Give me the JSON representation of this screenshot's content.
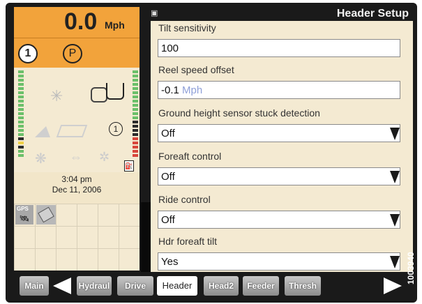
{
  "status": {
    "speed_value": "0.0",
    "speed_unit": "Mph",
    "gear": "1",
    "park": "P",
    "control_badge": "1",
    "fuel": "⛽",
    "time": "3:04 pm",
    "date": "Dec 11, 2006",
    "gps_label": "GPS"
  },
  "header": {
    "title": "Header Setup"
  },
  "settings": [
    {
      "label": "Tilt sensitivity",
      "value": "100",
      "unit": "",
      "dropdown": false
    },
    {
      "label": "Reel speed offset",
      "value": "-0.1",
      "unit": "Mph",
      "dropdown": false
    },
    {
      "label": "Ground height sensor stuck detection",
      "value": "Off",
      "unit": "",
      "dropdown": true
    },
    {
      "label": "Foreaft control",
      "value": "Off",
      "unit": "",
      "dropdown": true
    },
    {
      "label": "Ride control",
      "value": "Off",
      "unit": "",
      "dropdown": true
    },
    {
      "label": "Hdr foreaft tilt",
      "value": "Yes",
      "unit": "",
      "dropdown": true
    }
  ],
  "tabs": [
    {
      "label": "Main",
      "active": false
    },
    {
      "label": "Hydraul",
      "active": false
    },
    {
      "label": "Drive",
      "active": false
    },
    {
      "label": "Header",
      "active": true
    },
    {
      "label": "Head2",
      "active": false
    },
    {
      "label": "Feeder",
      "active": false
    },
    {
      "label": "Thresh",
      "active": false
    }
  ],
  "watermark": "1003940",
  "colors": {
    "status_orange": "#f2a33b",
    "panel_beige": "#f4ead2",
    "bezel": "#1a1a1a"
  },
  "icons": [
    "snowflake-icon",
    "reel-icon",
    "header-icon",
    "tilt-icon",
    "float-icon",
    "fan-icon",
    "arrows-icon",
    "spark-icon",
    "fuel-icon",
    "gps-icon",
    "card-icon"
  ]
}
